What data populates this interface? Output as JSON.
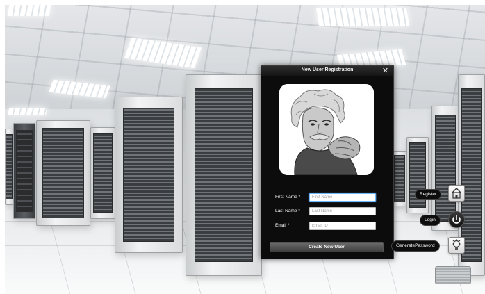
{
  "dialog": {
    "title": "New User Registration",
    "close_icon": "close-icon",
    "portrait_icon": "portrait-image",
    "fields": {
      "first_name": {
        "label": "First Name *",
        "placeholder": "First Name",
        "value": ""
      },
      "last_name": {
        "label": "Last Name *",
        "placeholder": "Last Name",
        "value": ""
      },
      "email": {
        "label": "Email *",
        "placeholder": "Email ID",
        "value": ""
      }
    },
    "submit_label": "Create New User"
  },
  "actions": {
    "register_label": "Register",
    "login_label": "Login",
    "generate_password_label": "GeneratePassword",
    "register_icon": "house-icon",
    "login_icon": "power-icon",
    "generate_password_icon": "lightbulb-icon"
  },
  "colors": {
    "dialog_bg": "#0c0c0c",
    "button_bg": "#4f4f4f",
    "focus_border": "#6db7ff"
  }
}
